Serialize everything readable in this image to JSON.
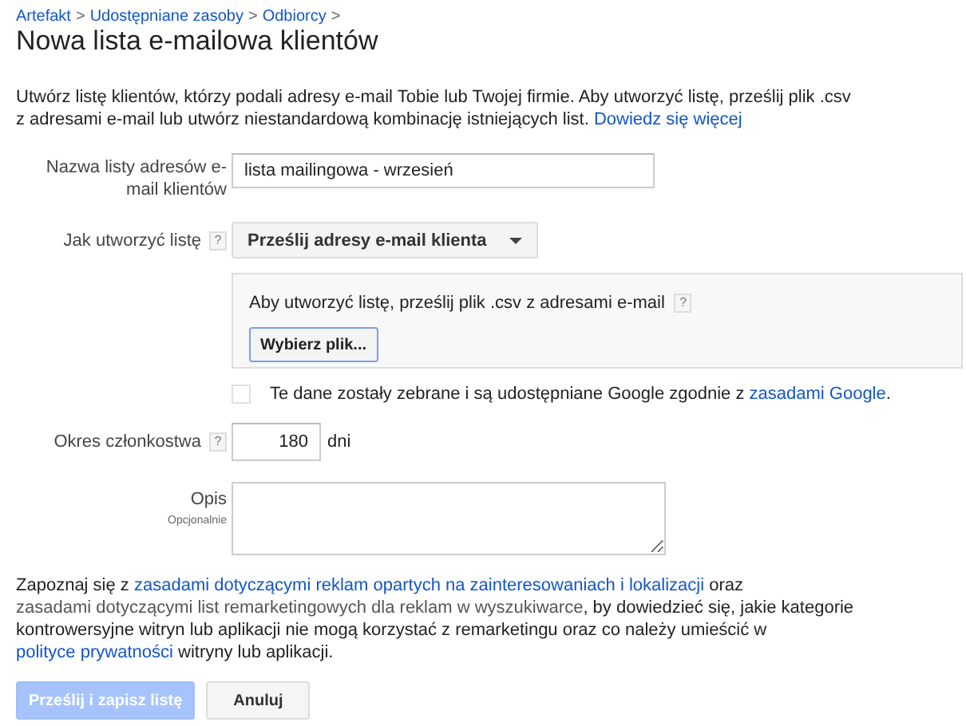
{
  "breadcrumbs": [
    {
      "label": "Artefakt"
    },
    {
      "label": "Udostępniane zasoby"
    },
    {
      "label": "Odbiorcy"
    }
  ],
  "breadcrumb_separator": ">",
  "title": "Nowa lista e-mailowa klientów",
  "intro": [
    {
      "kind": "text",
      "text": "Utwórz listę klientów, którzy podali adresy e-mail Tobie lub Twojej firmie. Aby utworzyć listę, prześlij plik .csv z adresami e-mail lub utwórz niestandardową kombinację istniejących list. "
    },
    {
      "kind": "link",
      "text": "Dowiedz się więcej"
    }
  ],
  "list_name": {
    "label": "Nazwa listy adresów e-mail klientów",
    "value": "lista mailingowa - wrzesień"
  },
  "method": {
    "label": "Jak utworzyć listę",
    "help": "?",
    "value": "Prześlij adresy e-mail klienta"
  },
  "upload": {
    "text": "Aby utworzyć listę, prześlij plik .csv z adresami e-mail",
    "help": "?",
    "button": "Wybierz plik..."
  },
  "consent": {
    "checked": false,
    "parts": [
      {
        "kind": "text",
        "text": "Te dane zostały zebrane i są udostępniane Google zgodnie z "
      },
      {
        "kind": "link",
        "text": "zasadami Google"
      },
      {
        "kind": "text",
        "text": "."
      }
    ]
  },
  "membership": {
    "label": "Okres członkostwa",
    "help": "?",
    "value": "180",
    "unit": "dni"
  },
  "description": {
    "label": "Opis",
    "hint": "Opcjonalnie"
  },
  "notice": [
    {
      "kind": "text",
      "text": "Zapoznaj się z "
    },
    {
      "kind": "link",
      "text": "zasadami dotyczącymi reklam opartych na zainteresowaniach i lokalizacji"
    },
    {
      "kind": "text",
      "text": " oraz "
    },
    {
      "kind": "link2",
      "text": "zasadami"
    },
    {
      "kind": "link2",
      "text": "dotyczącymi list remarketingowych dla reklam w wyszukiwarce"
    },
    {
      "kind": "text",
      "text": ", by dowiedzieć się, jakie kategorie kontrowersyjne witryn lub aplikacji nie mogą korzystać z remarketingu oraz co należy umieścić w "
    },
    {
      "kind": "link",
      "text": "polityce prywatności"
    },
    {
      "kind": "text",
      "text": " witryny lub aplikacji."
    }
  ],
  "buttons": [
    {
      "label": "Prześlij i zapisz listę",
      "kind": "primary",
      "disabled": true
    },
    {
      "label": "Anuluj",
      "kind": "secondary",
      "disabled": false
    }
  ]
}
